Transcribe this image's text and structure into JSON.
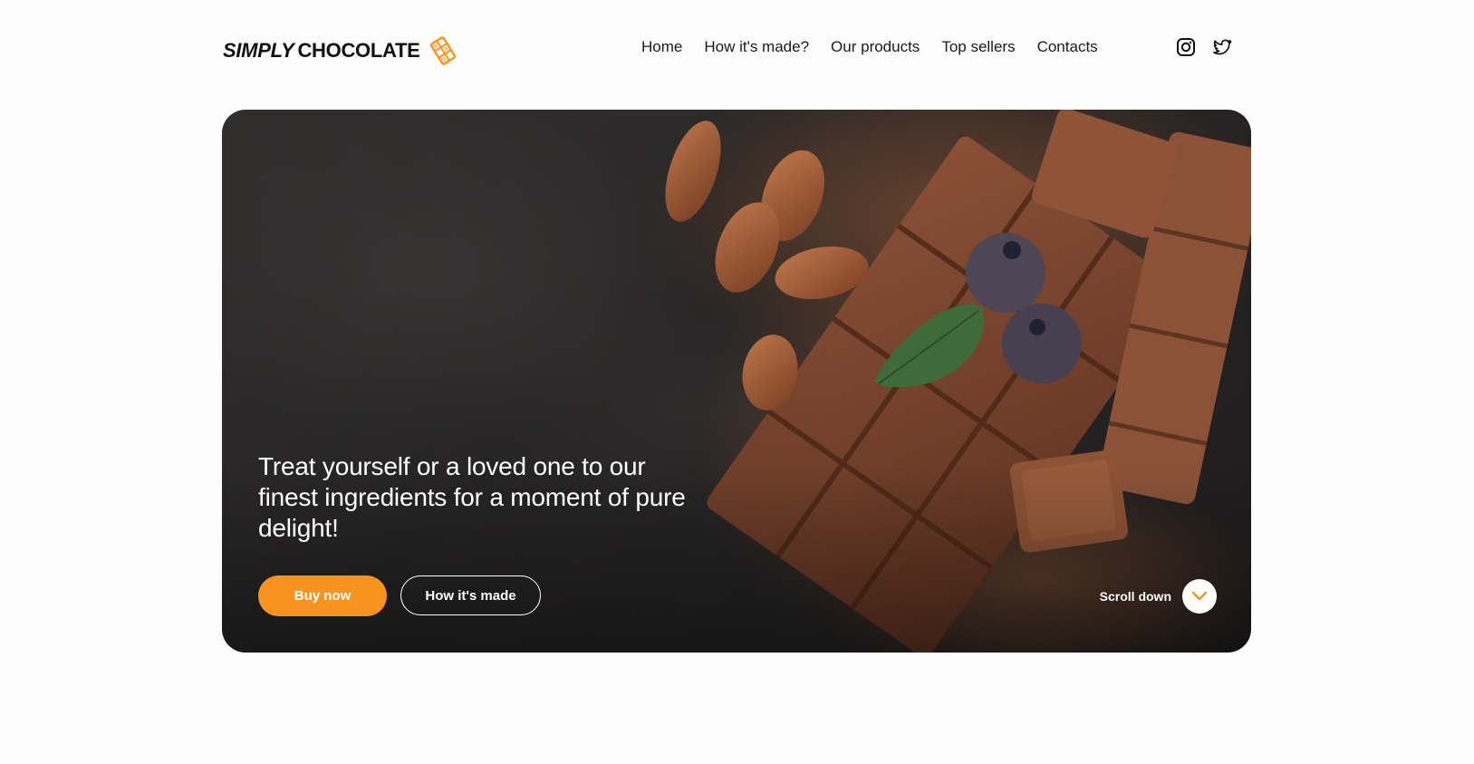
{
  "brand": {
    "name_italic": "SIMPLY",
    "name_plain": "CHOCOLATE",
    "accent_color": "#f7931e"
  },
  "nav": {
    "items": [
      {
        "label": "Home"
      },
      {
        "label": "How it's made?"
      },
      {
        "label": "Our products"
      },
      {
        "label": "Top sellers"
      },
      {
        "label": "Contacts"
      }
    ]
  },
  "social": {
    "icons": [
      "instagram-icon",
      "twitter-icon"
    ]
  },
  "hero": {
    "title": "Treat yourself or a loved one to our finest ingredients for a moment of pure delight!",
    "buy_label": "Buy now",
    "how_label": "How it's made",
    "scroll_label": "Scroll down",
    "scroll_icon": "chevron-down-icon"
  }
}
